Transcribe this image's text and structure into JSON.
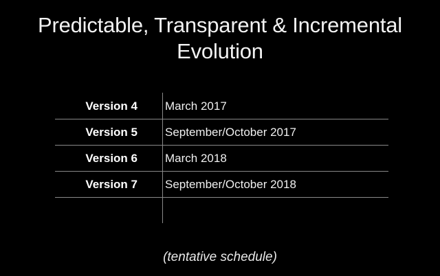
{
  "title": {
    "line1": "Predictable, Transparent & Incremental",
    "line2": "Evolution"
  },
  "schedule": {
    "rows": [
      {
        "version": "Version 4",
        "date": "March 2017"
      },
      {
        "version": "Version 5",
        "date": "September/October 2017"
      },
      {
        "version": "Version 6",
        "date": "March 2018"
      },
      {
        "version": "Version 7",
        "date": "September/October 2018"
      }
    ]
  },
  "note": "(tentative schedule)"
}
